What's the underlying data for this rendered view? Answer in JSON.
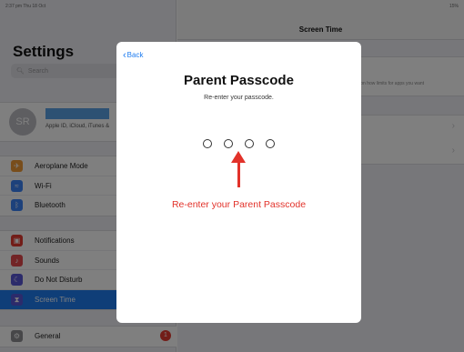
{
  "status_bar": {
    "time_date": "2:37 pm   Thu 18 Oct",
    "battery": "15%"
  },
  "sidebar": {
    "title": "Settings",
    "search_placeholder": "Search",
    "profile": {
      "initials": "SR",
      "subtitle": "Apple ID, iCloud, iTunes &"
    },
    "groups": [
      {
        "items": [
          {
            "label": "Aeroplane Mode",
            "icon": "airplane-icon",
            "color": "#f09a37"
          },
          {
            "label": "Wi-Fi",
            "icon": "wifi-icon",
            "color": "#3b82f6"
          },
          {
            "label": "Bluetooth",
            "icon": "bluetooth-icon",
            "color": "#3b82f6"
          }
        ]
      },
      {
        "items": [
          {
            "label": "Notifications",
            "icon": "notifications-icon",
            "color": "#e53b30"
          },
          {
            "label": "Sounds",
            "icon": "sounds-icon",
            "color": "#e5484d"
          },
          {
            "label": "Do Not Disturb",
            "icon": "moon-icon",
            "color": "#5856d6"
          },
          {
            "label": "Screen Time",
            "icon": "hourglass-icon",
            "color": "#5856d6",
            "selected": true
          }
        ]
      },
      {
        "items": [
          {
            "label": "General",
            "icon": "gear-icon",
            "color": "#8e8e93",
            "badge": "1"
          }
        ]
      }
    ]
  },
  "detail": {
    "title": "Screen Time",
    "info_text": "...ion how limits for apps you want"
  },
  "modal": {
    "back_label": "Back",
    "title": "Parent Passcode",
    "subtitle": "Re-enter your passcode.",
    "passcode_length": 4
  },
  "annotation": {
    "text": "Re-enter your Parent Passcode",
    "color": "#e2322a"
  }
}
